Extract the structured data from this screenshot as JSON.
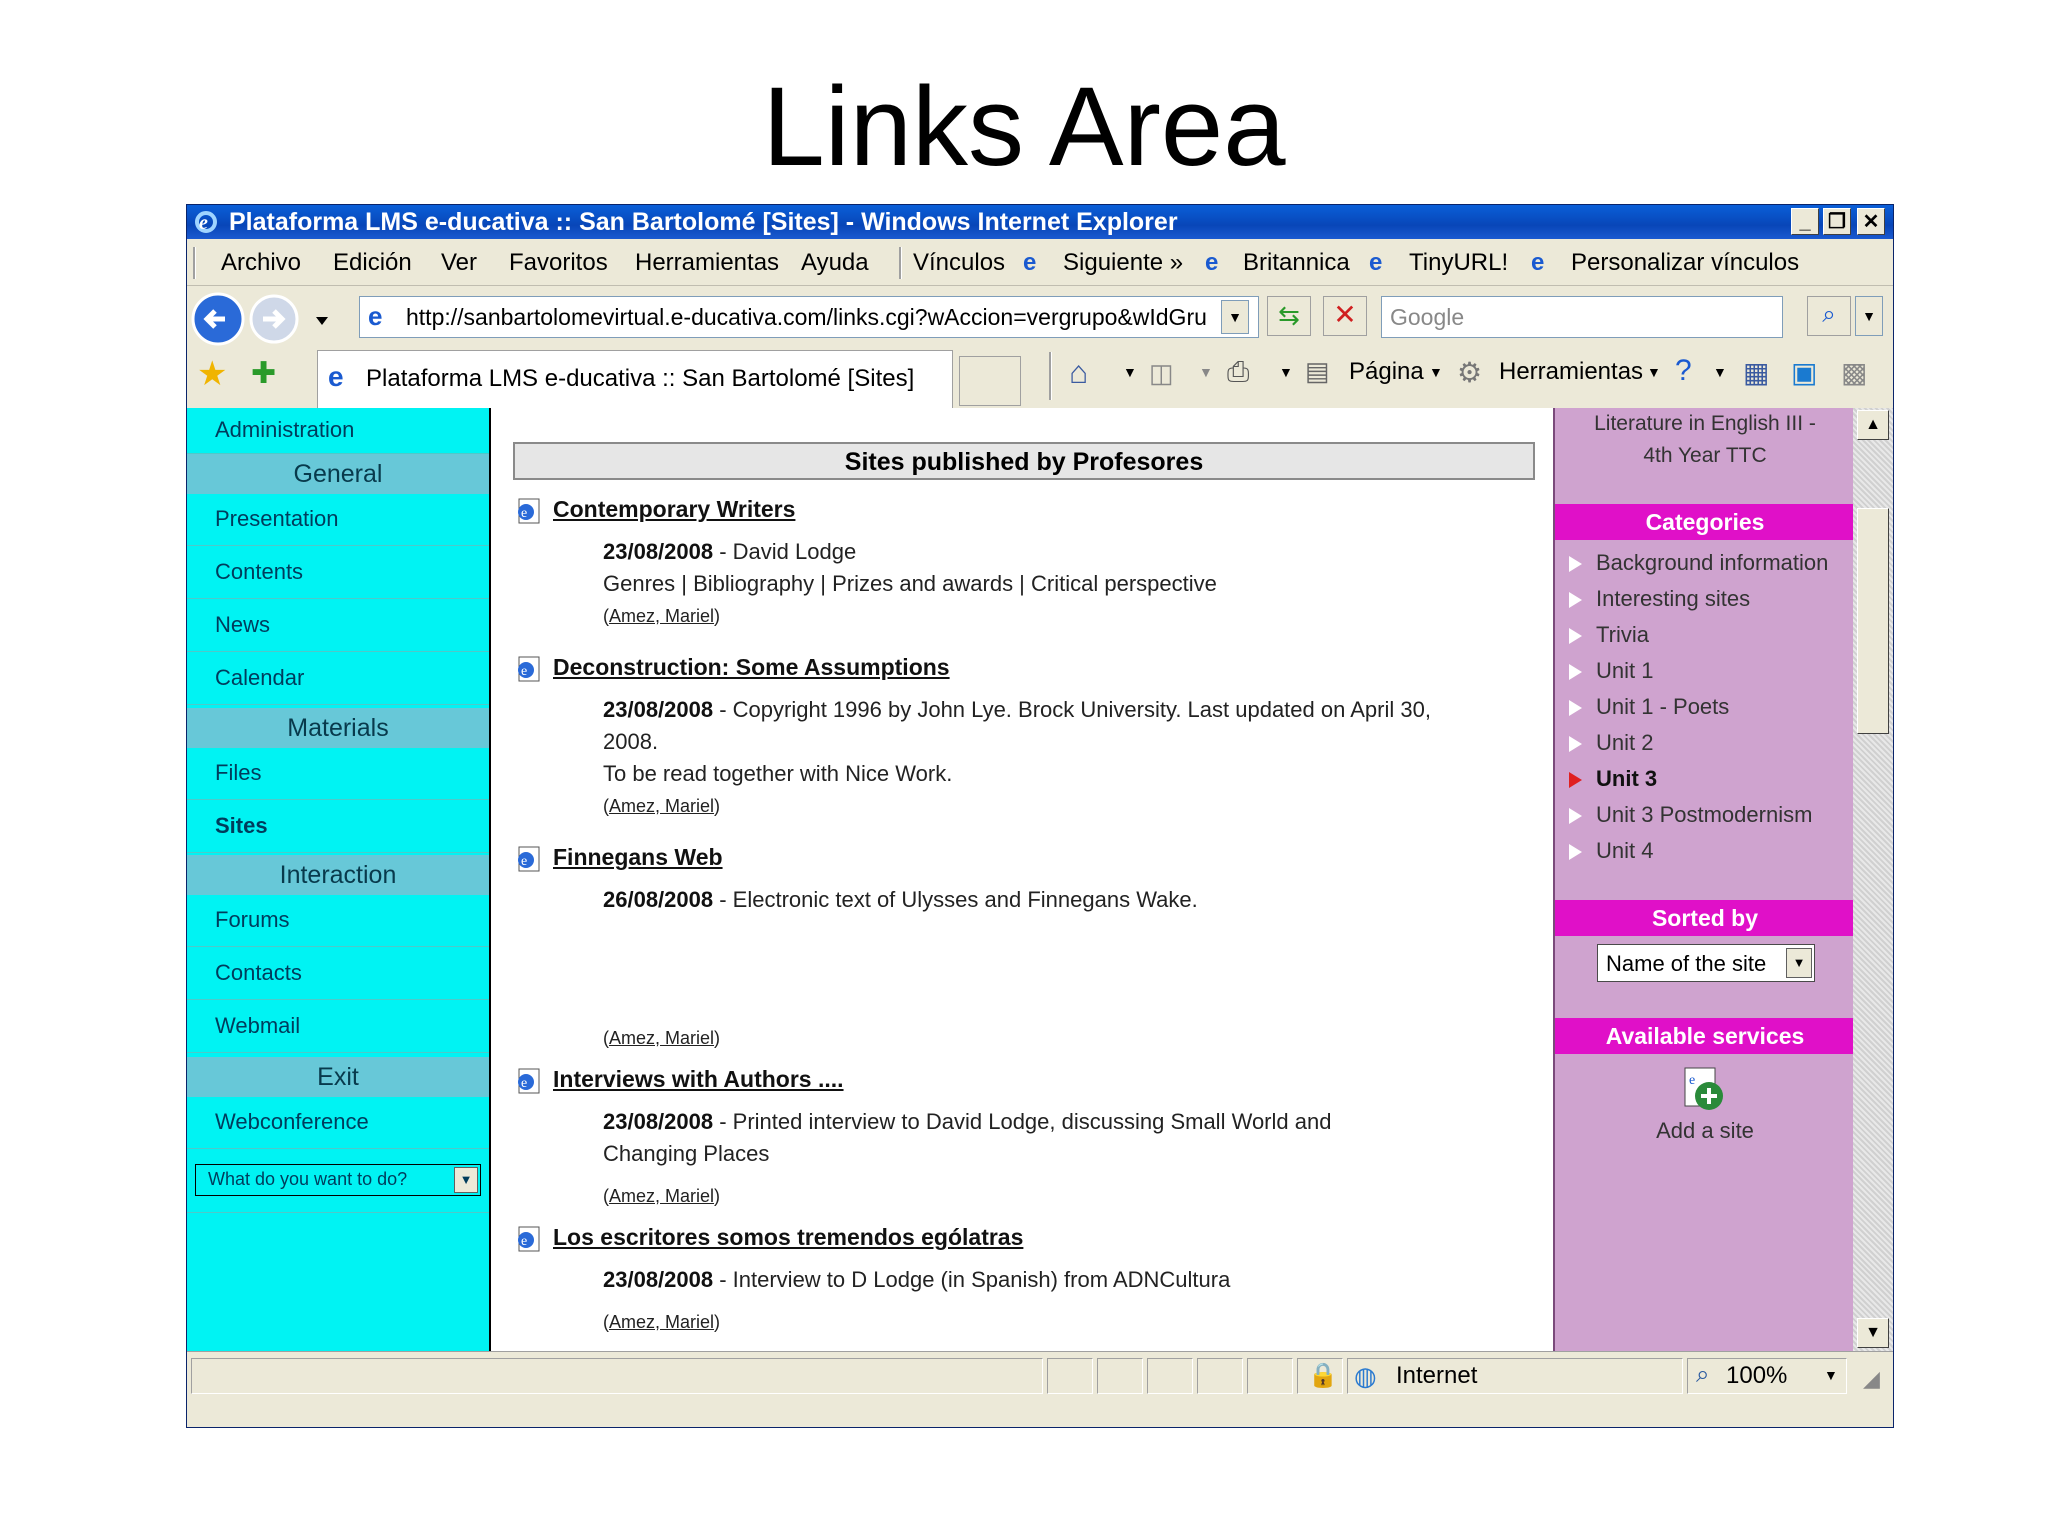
{
  "slide_title": "Links Area",
  "window": {
    "title": "Plataforma LMS e-ducativa :: San Bartolomé [Sites] - Windows Internet Explorer",
    "controls": {
      "minimize": "_",
      "restore": "❐",
      "close": "✕"
    }
  },
  "menu": {
    "items": [
      "Archivo",
      "Edición",
      "Ver",
      "Favoritos",
      "Herramientas",
      "Ayuda"
    ],
    "links_label": "Vínculos",
    "links": [
      "Siguiente »",
      "Britannica",
      "TinyURL!",
      "Personalizar vínculos"
    ]
  },
  "address": {
    "url": "http://sanbartolomevirtual.e-ducativa.com/links.cgi?wAccion=vergrupo&wIdGru",
    "search_placeholder": "Google"
  },
  "tabbar": {
    "tab_title": "Plataforma LMS e-ducativa :: San Bartolomé [Sites]",
    "pagina_label": "Página",
    "herramientas_label": "Herramientas"
  },
  "left_nav": {
    "admin": "Administration",
    "sections": [
      {
        "header": "General",
        "items": [
          "Presentation",
          "Contents",
          "News",
          "Calendar"
        ]
      },
      {
        "header": "Materials",
        "items": [
          "Files",
          "Sites"
        ]
      },
      {
        "header": "Interaction",
        "items": [
          "Forums",
          "Contacts",
          "Webmail"
        ]
      },
      {
        "header": "Exit",
        "items": [
          "Webconference"
        ]
      }
    ],
    "action_select": "What do you want to do?"
  },
  "main": {
    "section_title": "Sites published by Profesores",
    "entries": [
      {
        "title": "Contemporary Writers",
        "date": "23/08/2008",
        "line1": " - David Lodge",
        "line2": "Genres | Bibliography | Prizes and awards | Critical perspective",
        "author": "Amez, Mariel"
      },
      {
        "title": "Deconstruction: Some Assumptions",
        "date": "23/08/2008",
        "line1": " - Copyright 1996 by John Lye. Brock University. Last updated on April 30, 2008.",
        "line2": "To be read together with Nice Work.",
        "author": "Amez, Mariel"
      },
      {
        "title": "Finnegans Web",
        "date": "26/08/2008",
        "line1": " - Electronic text of Ulysses and Finnegans Wake.",
        "line2": "",
        "author": "Amez, Mariel"
      },
      {
        "title": "Interviews with Authors ....",
        "date": "23/08/2008",
        "line1": " - Printed interview to David Lodge, discussing Small World and Changing Places",
        "line2": "",
        "author": "Amez, Mariel"
      },
      {
        "title": "Los escritores somos tremendos ególatras",
        "date": "23/08/2008",
        "line1": " - Interview to D Lodge (in Spanish) from ADNCultura",
        "line2": "",
        "author": "Amez, Mariel"
      }
    ]
  },
  "right_panel": {
    "course": "Literature in English III - 4th Year TTC",
    "categories_header": "Categories",
    "categories": [
      "Background information",
      "Interesting sites",
      "Trivia",
      "Unit 1",
      "Unit 1 - Poets",
      "Unit 2",
      "Unit 3",
      "Unit 3 Postmodernism",
      "Unit 4"
    ],
    "active_category": "Unit 3",
    "sorted_header": "Sorted by",
    "sorted_value": "Name of the site",
    "services_header": "Available services",
    "add_site": "Add a site"
  },
  "statusbar": {
    "zone": "Internet",
    "zoom": "100%"
  },
  "colors": {
    "left_nav_bg": "#00f3f3",
    "left_header_bg": "#67c8d8",
    "right_bg": "#cfa3cf",
    "right_header_bg": "#e010c8",
    "titlebar": "#0a5fd8"
  }
}
